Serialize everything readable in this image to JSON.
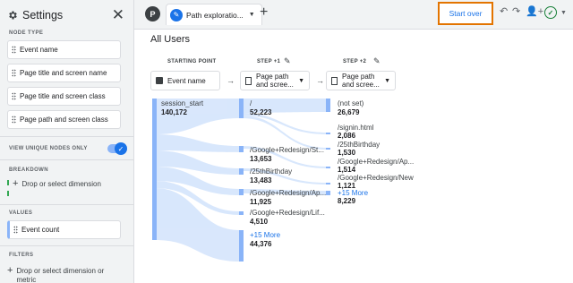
{
  "panel": {
    "title": "Settings",
    "node_type_label": "NODE TYPE",
    "node_types": [
      "Event name",
      "Page title and screen name",
      "Page title and screen class",
      "Page path and screen class"
    ],
    "toggle_label": "VIEW UNIQUE NODES ONLY",
    "toggle_on": true,
    "breakdown_label": "BREAKDOWN",
    "breakdown_drop": "Drop or select dimension",
    "values_label": "VALUES",
    "value_chip": "Event count",
    "filters_label": "FILTERS",
    "filters_drop": "Drop or select dimension or metric"
  },
  "tabs": {
    "avatar_letter": "P",
    "active_tab": "Path exploratio..."
  },
  "toolbar": {
    "start_over": "Start over",
    "accent": "#e37400"
  },
  "canvas": {
    "title": "All Users",
    "starting_point": "STARTING POINT",
    "step1": "STEP +1",
    "step2": "STEP +2",
    "sel_start": "Event name",
    "sel_step1_line1": "Page path",
    "sel_step1_line2": "and scree...",
    "sel_step2_line1": "Page path",
    "sel_step2_line2": "and scree..."
  },
  "nodes": {
    "start": {
      "label": "session_start",
      "value": "140,172"
    },
    "step1": [
      {
        "label": "/",
        "value": "52,223"
      },
      {
        "label": "/Google+Redesign/St...",
        "value": "13,653"
      },
      {
        "label": "/25thBirthday",
        "value": "13,483"
      },
      {
        "label": "/Google+Redesign/Ap...",
        "value": "11,925"
      },
      {
        "label": "/Google+Redesign/Lif...",
        "value": "4,510"
      },
      {
        "label": "+15 More",
        "value": "44,376"
      }
    ],
    "step2": [
      {
        "label": "(not set)",
        "value": "26,679"
      },
      {
        "label": "/signin.html",
        "value": "2,086"
      },
      {
        "label": "/25thBirthday",
        "value": "1,530"
      },
      {
        "label": "/Google+Redesign/Ap...",
        "value": "1,514"
      },
      {
        "label": "/Google+Redesign/New",
        "value": "1,121"
      },
      {
        "label": "+15 More",
        "value": "8,229"
      }
    ]
  },
  "colors": {
    "node": "#8ab4f8",
    "flow": "#d2e3fc",
    "link": "#1a73e8"
  }
}
